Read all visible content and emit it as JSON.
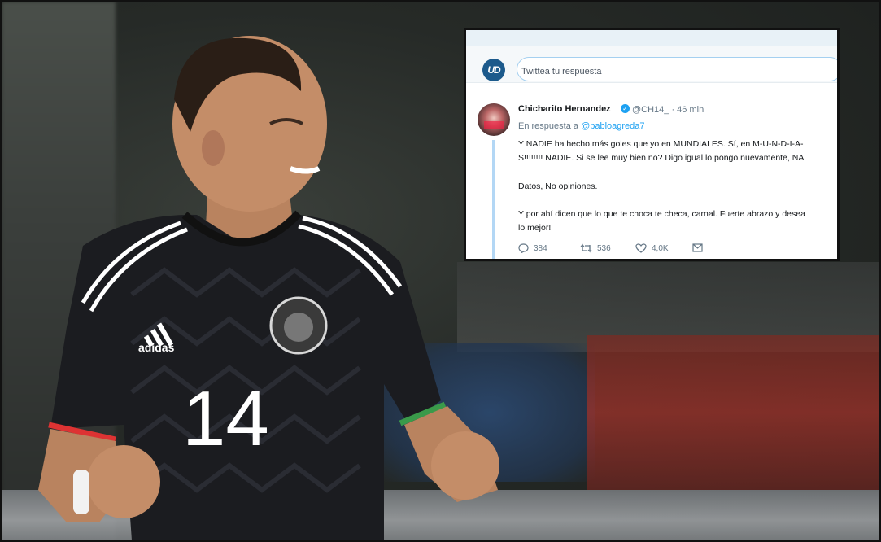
{
  "tweet": {
    "reply_placeholder": "Twittea tu respuesta",
    "logo_text": "UD",
    "author_name": "Chicharito Hernandez",
    "verified_icon": "verified-badge-icon",
    "handle_time": "@CH14_ · 46 min",
    "replying_prefix": "En respuesta a",
    "replying_to": "@pabloagreda7",
    "body_lines": [
      "Y NADIE ha hecho más goles que yo en MUNDIALES. Sí, en M-U-N-D-I-A-",
      "S!!!!!!!! NADIE. Si se lee muy bien no? Digo igual lo pongo nuevamente, NA",
      "Datos, No opiniones.",
      "Y por ahí dicen que lo que te choca te checa, carnal. Fuerte abrazo y desea",
      "lo mejor!"
    ],
    "actions": {
      "replies": "384",
      "retweets": "536",
      "likes": "4,0K"
    }
  },
  "player": {
    "shirt_brand": "adidas",
    "shirt_number": "14"
  },
  "colors": {
    "twitter_blue": "#1da1f2",
    "shirt_black": "#1b1c20",
    "shirt_stripe": "#ffffff"
  }
}
